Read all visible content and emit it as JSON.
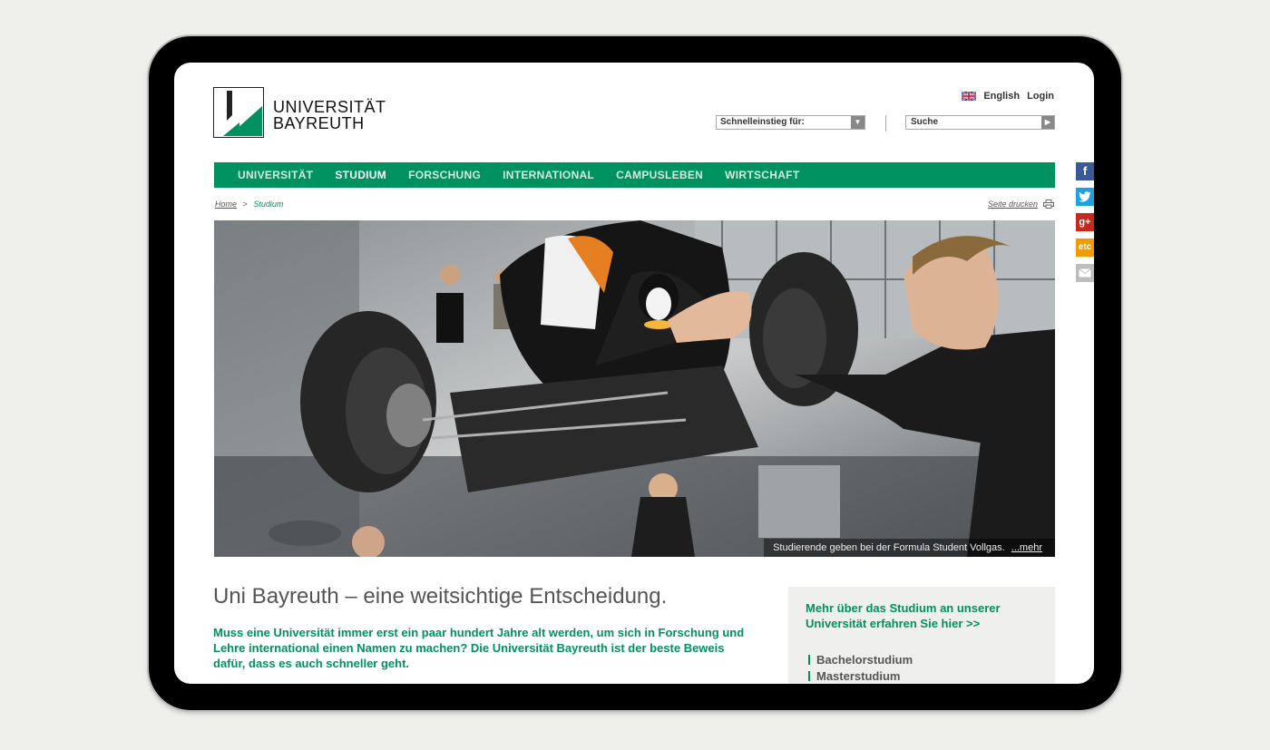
{
  "header": {
    "logo_line1": "UNIVERSITÄT",
    "logo_line2": "BAYREUTH",
    "lang_label": "English",
    "login_label": "Login",
    "quick_access_label": "Schnelleinstieg für:",
    "search_placeholder": "Suche"
  },
  "nav": {
    "items": [
      "UNIVERSITÄT",
      "STUDIUM",
      "FORSCHUNG",
      "INTERNATIONAL",
      "CAMPUSLEBEN",
      "WIRTSCHAFT"
    ],
    "active": "STUDIUM"
  },
  "breadcrumb": {
    "home": "Home",
    "separator": ">",
    "current": "Studium"
  },
  "print_label": "Seite drucken",
  "hero": {
    "caption": "Studierende geben bei der Formula Student Vollgas.",
    "more_link": "...mehr"
  },
  "social": {
    "icons": [
      "facebook-icon",
      "twitter-icon",
      "google-plus-icon",
      "etc-icon",
      "mail-icon"
    ],
    "labels": {
      "facebook": "f",
      "google_plus": "g+",
      "etc": "etc"
    },
    "colors": {
      "facebook": "#3b5998",
      "twitter": "#1da1e2",
      "google_plus": "#c7281d",
      "etc": "#f29b00",
      "mail": "#bdbdbd"
    }
  },
  "main": {
    "headline": "Uni Bayreuth – eine weitsichtige Entscheidung.",
    "intro": "Muss eine Universität immer erst ein paar hundert Jahre alt werden, um sich in Forschung und Lehre international einen Namen zu machen? Die Universität Bayreuth ist der beste Beweis dafür, dass es auch schneller geht."
  },
  "sidebar": {
    "heading": "Mehr über das Studium an unserer Universität erfahren Sie hier >>",
    "links": [
      "Bachelorstudium",
      "Masterstudium"
    ]
  },
  "colors": {
    "brand_green": "#009160"
  }
}
